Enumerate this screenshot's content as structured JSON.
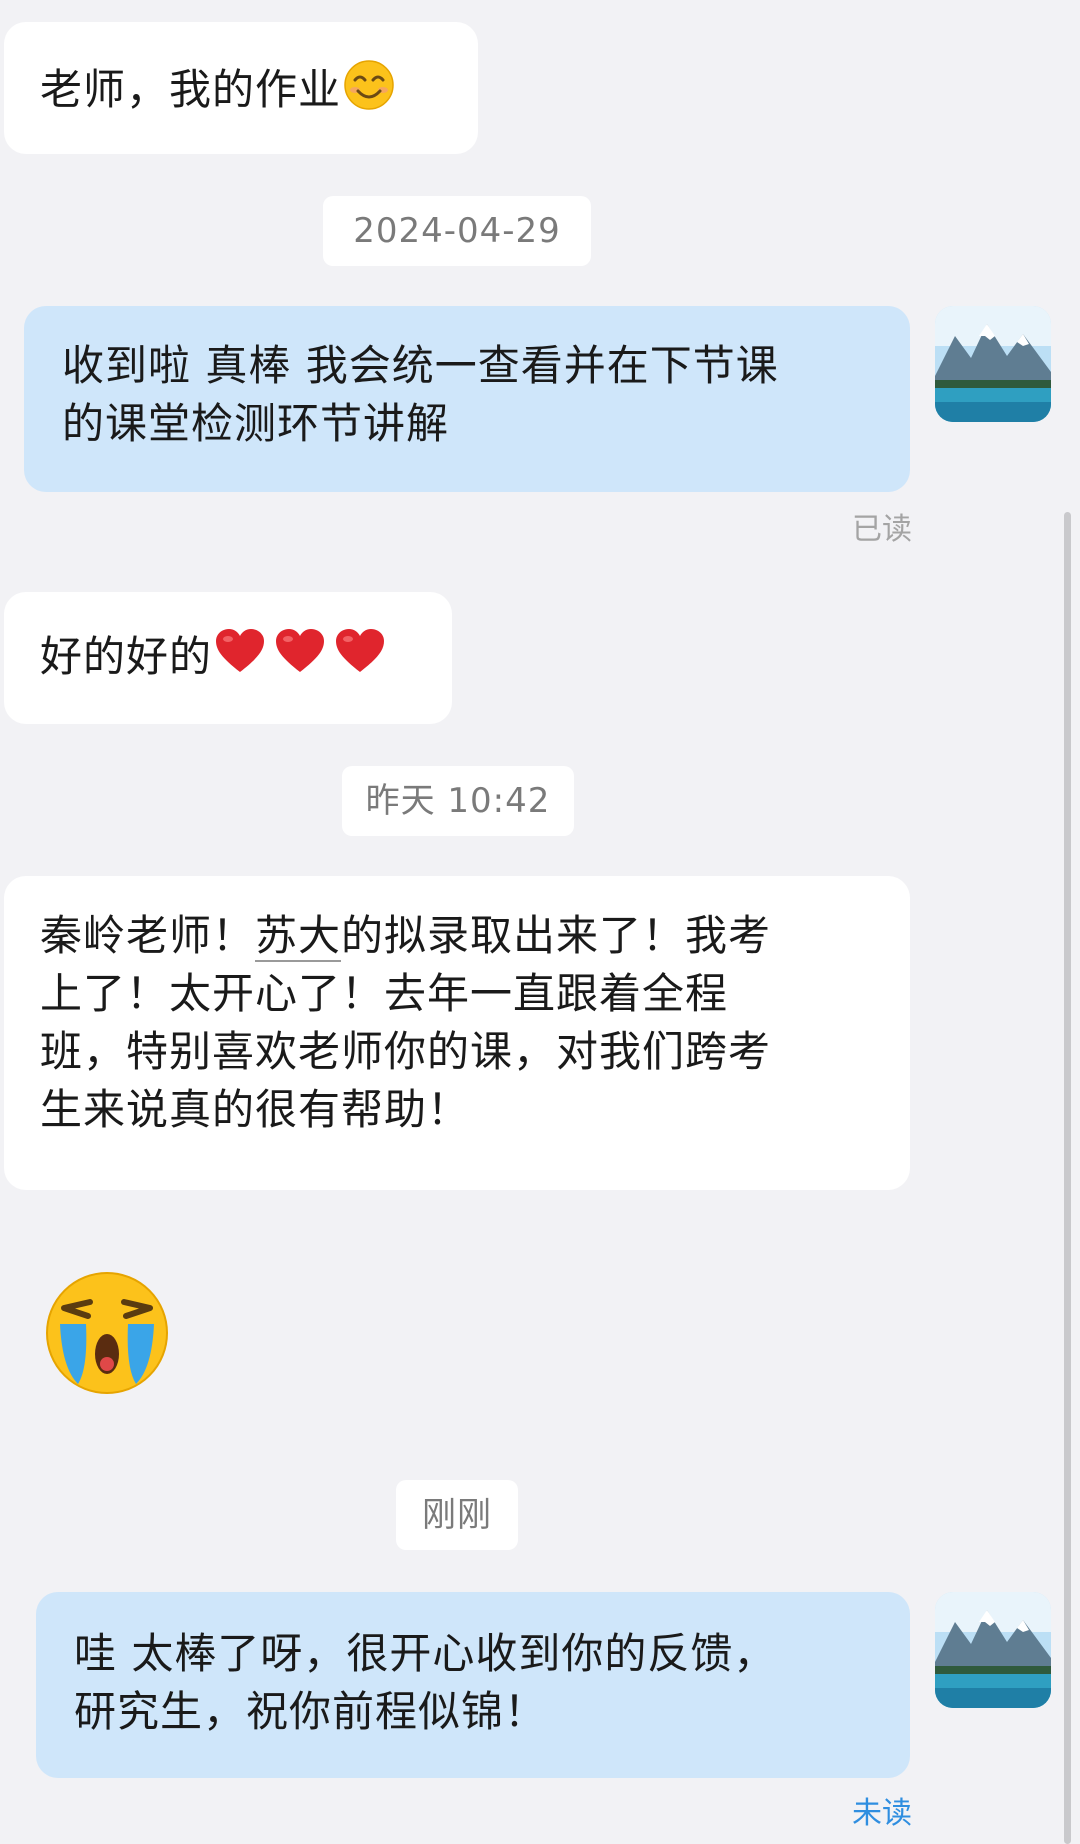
{
  "messages": [
    {
      "text": "老师，我的作业",
      "emoji": "smiling-face-icon"
    },
    {
      "time": "2024-04-29"
    },
    {
      "text": "收到啦 真棒 我会统一查看并在下节课的课堂检测环节讲解",
      "line1": "收到啦 真棒 我会统一查看并在下节课",
      "line2": "的课堂检测环节讲解",
      "receipt": "已读"
    },
    {
      "text": "好的好的",
      "emoji": "red-heart-icon"
    },
    {
      "time": "昨天 10:42"
    },
    {
      "line1_a": "秦岭老师！",
      "line1_link": "苏大",
      "line1_b": "的拟录取出来了！我考",
      "line2": "上了！太开心了！去年一直跟着全程",
      "line3": "班，特别喜欢老师你的课，对我们跨考",
      "line4": "生来说真的很有帮助！"
    },
    {
      "emoji": "loudly-crying-face-icon"
    },
    {
      "time": "刚刚"
    },
    {
      "line1": "哇 太棒了呀，很开心收到你的反馈，",
      "line2": "研究生，祝你前程似锦！",
      "receipt": "未读"
    }
  ],
  "colors": {
    "background": "#f2f2f5",
    "incoming_bubble": "#ffffff",
    "outgoing_bubble": "#cfe6fa",
    "read_receipt": "#a4a4a4",
    "unread_receipt": "#2f8ee0"
  }
}
